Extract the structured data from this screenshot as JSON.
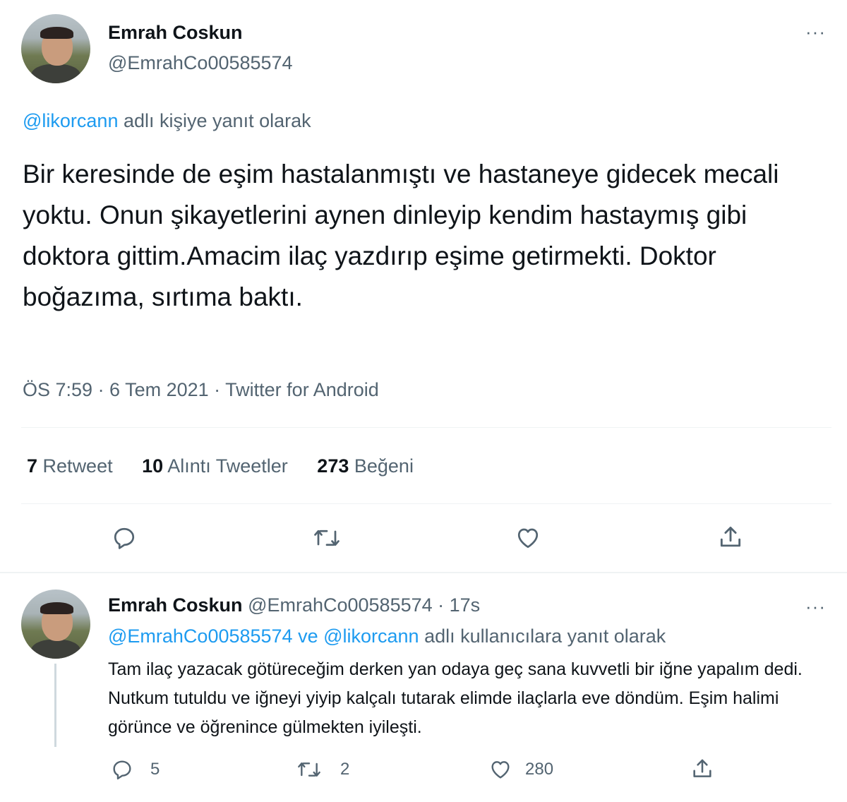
{
  "main_tweet": {
    "author_name": "Emrah Coskun",
    "author_handle": "@EmrahCo00585574",
    "reply_to_handle": "@likorcann",
    "reply_to_suffix": "adlı kişiye yanıt olarak",
    "text": "Bir keresinde de eşim hastalanmıştı ve hastaneye gidecek mecali yoktu. Onun şikayetlerini aynen dinleyip kendim hastaymış gibi doktora gittim.Amacim ilaç yazdırıp eşime getirmekti. Doktor boğazıma, sırtıma baktı.",
    "meta": "ÖS 7:59 · 6 Tem 2021 · Twitter for Android",
    "stats": {
      "retweets_count": "7",
      "retweets_label": "Retweet",
      "quotes_count": "10",
      "quotes_label": "Alıntı Tweetler",
      "likes_count": "273",
      "likes_label": "Beğeni"
    },
    "actions": [
      "reply-icon",
      "retweet-icon",
      "like-icon",
      "share-icon"
    ]
  },
  "reply_tweet": {
    "author_name": "Emrah Coskun",
    "author_handle": "@EmrahCo00585574",
    "time": "· 17s",
    "reply_to_handles": "@EmrahCo00585574 ve @likorcann",
    "reply_to_suffix": "adlı kullanıcılara yanıt olarak",
    "text": "Tam ilaç yazacak götüreceğim derken yan odaya geç sana kuvvetli bir iğne yapalım dedi. Nutkum tutuldu ve iğneyi yiyip kalçalı tutarak elimde ilaçlarla eve döndüm. Eşim halimi görünce ve öğrenince gülmekten iyileşti.",
    "reply_count": "5",
    "retweet_count": "2",
    "like_count": "280"
  },
  "more_glyph": "···",
  "colors": {
    "accent": "#1d9bf0",
    "secondary": "#536471",
    "divider": "#eff3f4"
  }
}
